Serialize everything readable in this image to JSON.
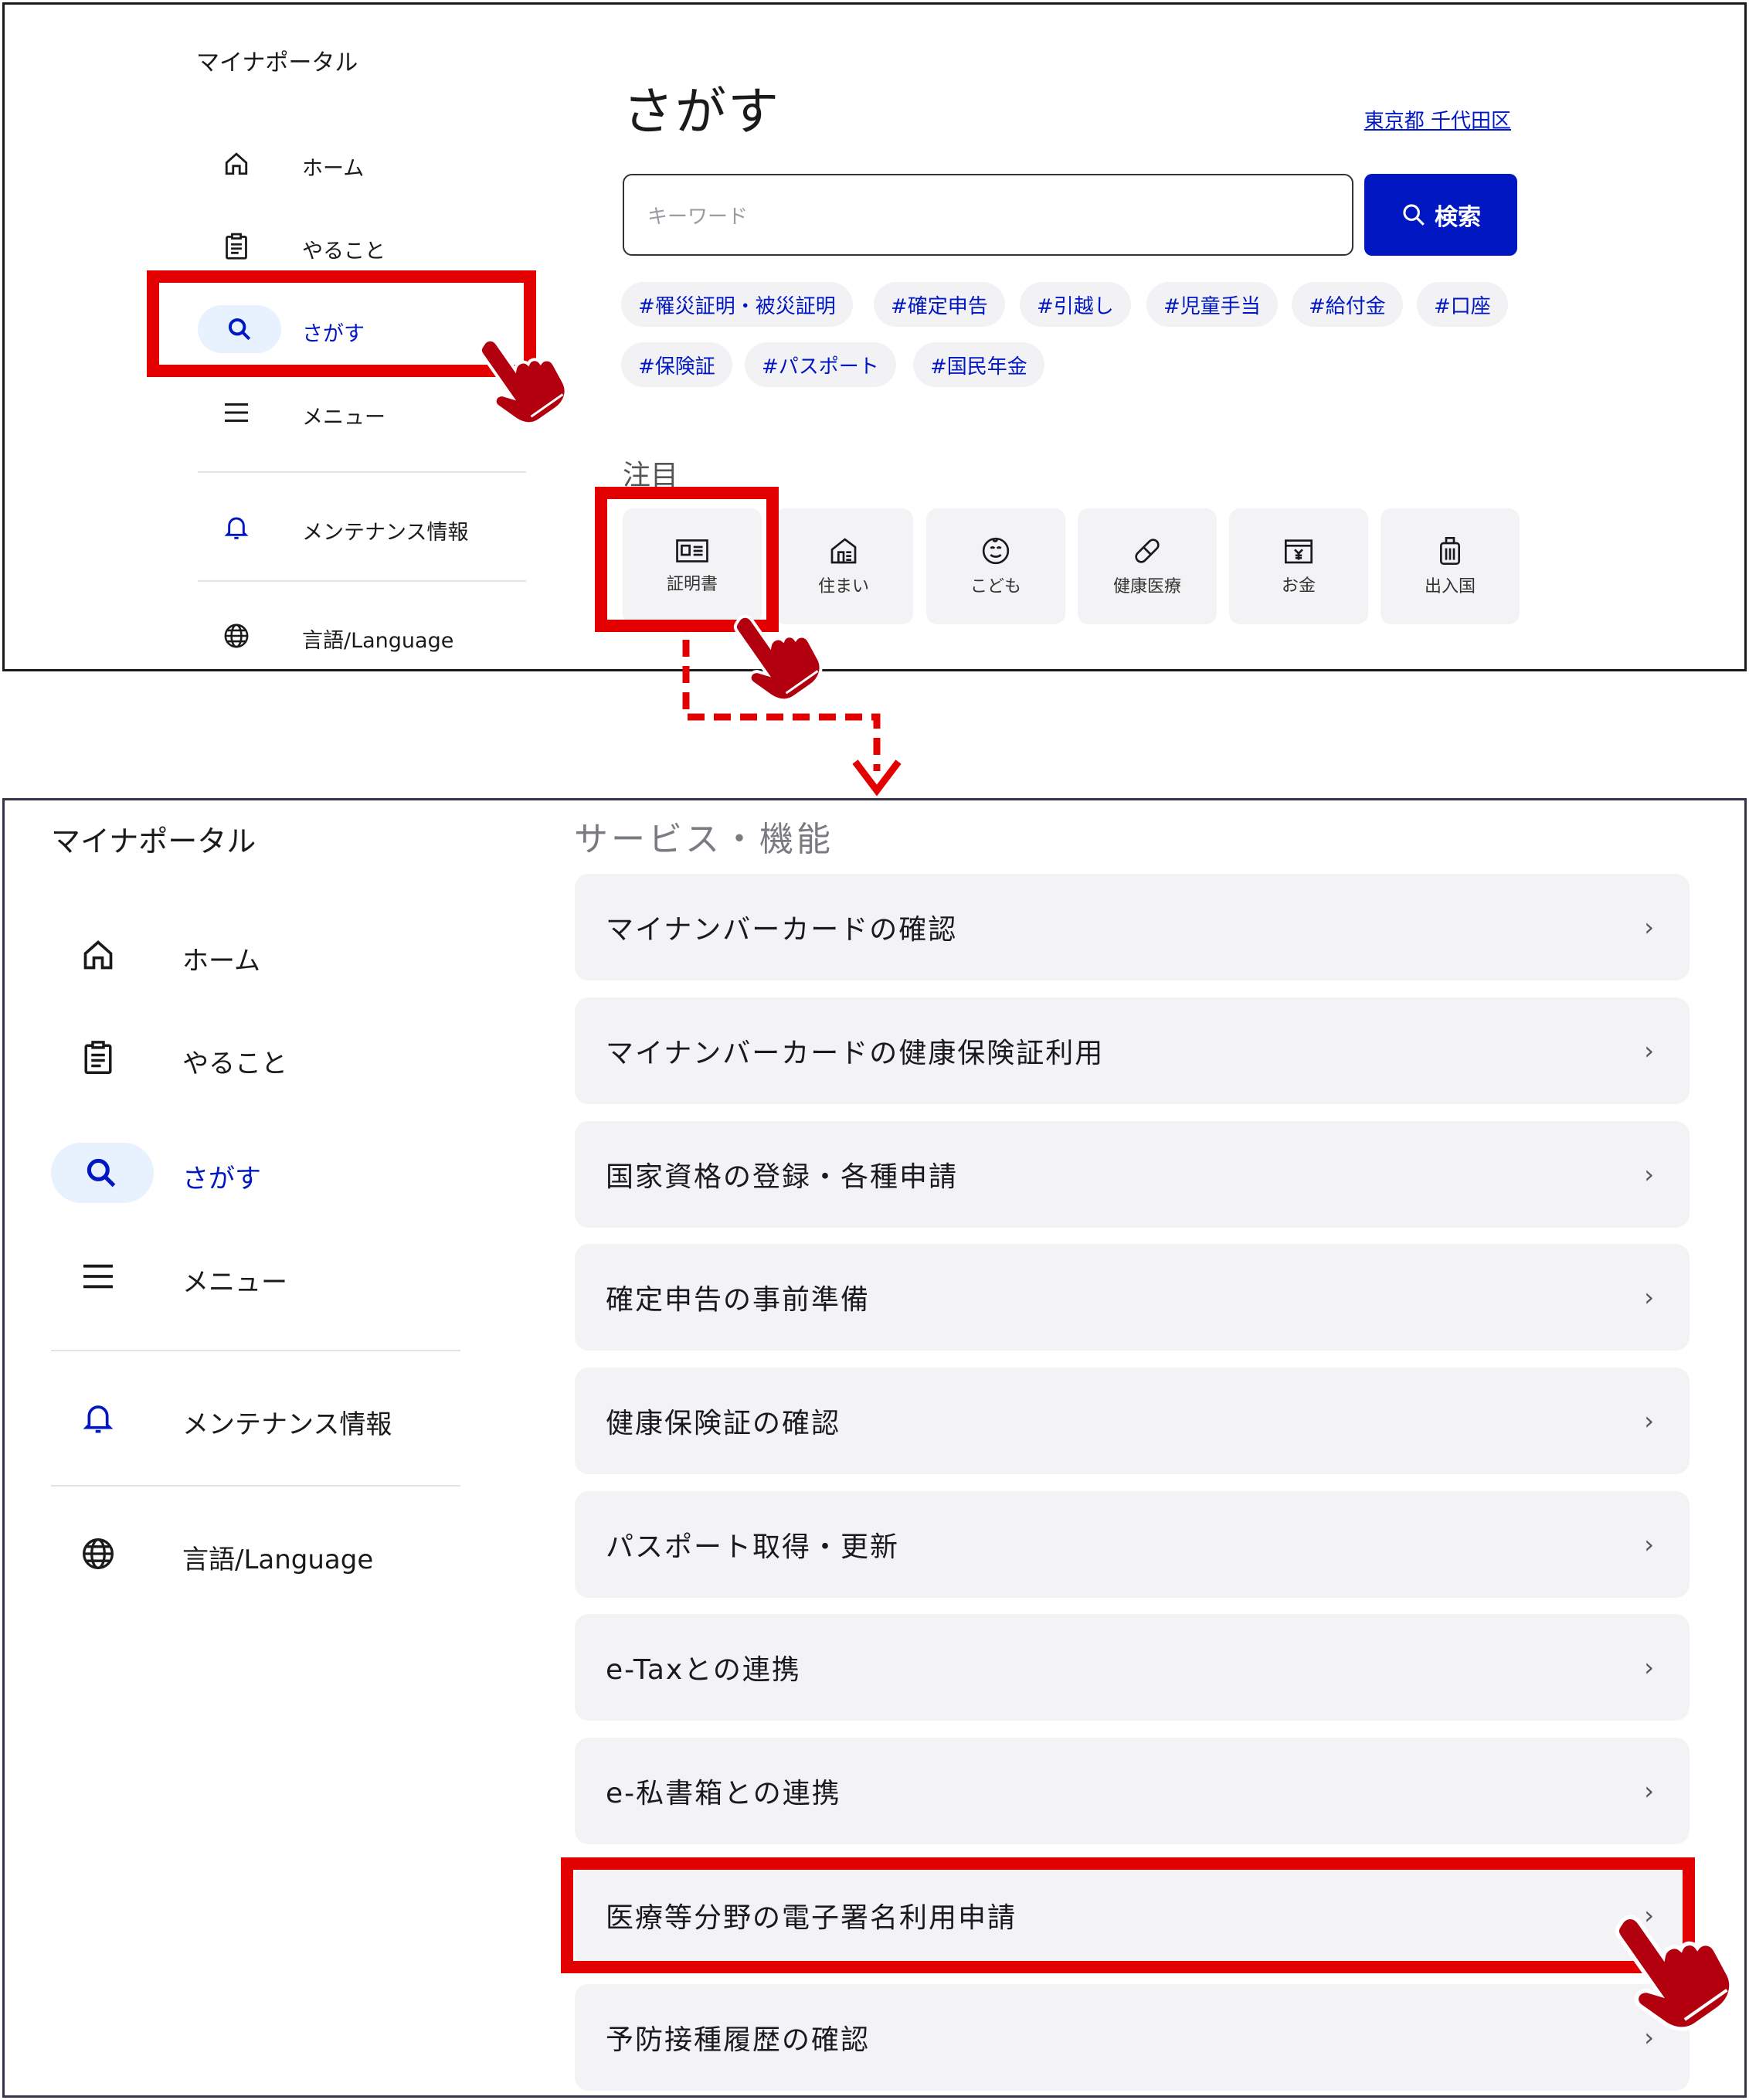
{
  "top": {
    "brand": "マイナポータル",
    "nav": [
      {
        "label": "ホーム",
        "icon": "home-icon"
      },
      {
        "label": "やること",
        "icon": "clipboard-icon"
      },
      {
        "label": "さがす",
        "icon": "search-icon"
      },
      {
        "label": "メニュー",
        "icon": "menu-icon"
      },
      {
        "label": "メンテナンス情報",
        "icon": "bell-icon"
      },
      {
        "label": "言語/Language",
        "icon": "globe-icon"
      }
    ],
    "title": "さがす",
    "location": "東京都 千代田区",
    "search": {
      "placeholder": "キーワード",
      "button": "検索"
    },
    "tags": [
      "#罹災証明・被災証明",
      "#確定申告",
      "#引越し",
      "#児童手当",
      "#給付金",
      "#口座",
      "#保険証",
      "#パスポート",
      "#国民年金"
    ],
    "section": "注目",
    "categories": [
      {
        "label": "証明書",
        "icon": "id-card-icon"
      },
      {
        "label": "住まい",
        "icon": "house-icon"
      },
      {
        "label": "こども",
        "icon": "child-face-icon"
      },
      {
        "label": "健康医療",
        "icon": "pill-icon"
      },
      {
        "label": "お金",
        "icon": "yen-icon"
      },
      {
        "label": "出入国",
        "icon": "suitcase-icon"
      }
    ]
  },
  "bottom": {
    "brand": "マイナポータル",
    "nav": [
      {
        "label": "ホーム",
        "icon": "home-icon"
      },
      {
        "label": "やること",
        "icon": "clipboard-icon"
      },
      {
        "label": "さがす",
        "icon": "search-icon"
      },
      {
        "label": "メニュー",
        "icon": "menu-icon"
      },
      {
        "label": "メンテナンス情報",
        "icon": "bell-icon"
      },
      {
        "label": "言語/Language",
        "icon": "globe-icon"
      }
    ],
    "section": "サービス・機能",
    "services": [
      "マイナンバーカードの確認",
      "マイナンバーカードの健康保険証利用",
      "国家資格の登録・各種申請",
      "確定申告の事前準備",
      "健康保険証の確認",
      "パスポート取得・更新",
      "e-Taxとの連携",
      "e-私書箱との連携",
      "医療等分野の電子署名利用申請",
      "予防接種履歴の確認"
    ],
    "chevron": "›"
  },
  "colors": {
    "accent": "#0017c1",
    "highlight": "#e30000",
    "pointer": "#b3000f",
    "active_bg": "#e8f1fe"
  }
}
